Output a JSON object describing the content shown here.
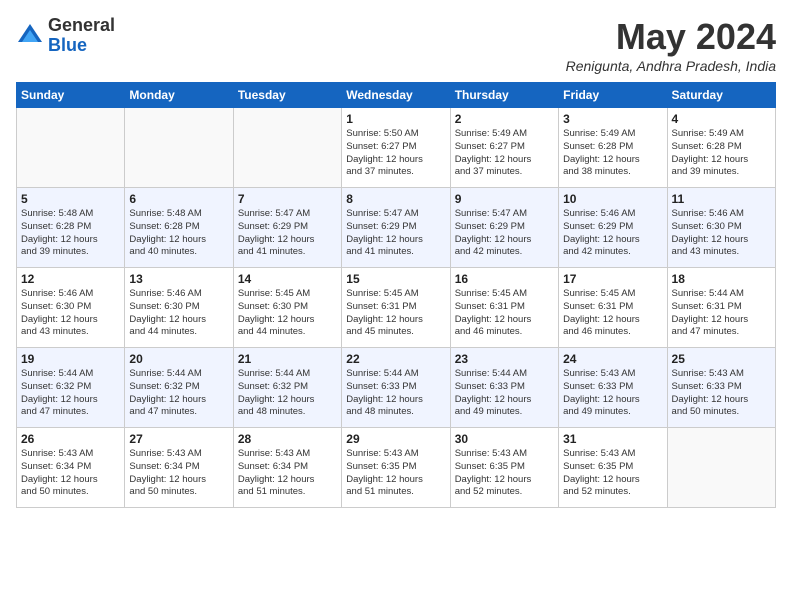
{
  "header": {
    "logo_general": "General",
    "logo_blue": "Blue",
    "month_title": "May 2024",
    "location": "Renigunta, Andhra Pradesh, India"
  },
  "days_of_week": [
    "Sunday",
    "Monday",
    "Tuesday",
    "Wednesday",
    "Thursday",
    "Friday",
    "Saturday"
  ],
  "weeks": [
    [
      {
        "day": "",
        "info": ""
      },
      {
        "day": "",
        "info": ""
      },
      {
        "day": "",
        "info": ""
      },
      {
        "day": "1",
        "info": "Sunrise: 5:50 AM\nSunset: 6:27 PM\nDaylight: 12 hours\nand 37 minutes."
      },
      {
        "day": "2",
        "info": "Sunrise: 5:49 AM\nSunset: 6:27 PM\nDaylight: 12 hours\nand 37 minutes."
      },
      {
        "day": "3",
        "info": "Sunrise: 5:49 AM\nSunset: 6:28 PM\nDaylight: 12 hours\nand 38 minutes."
      },
      {
        "day": "4",
        "info": "Sunrise: 5:49 AM\nSunset: 6:28 PM\nDaylight: 12 hours\nand 39 minutes."
      }
    ],
    [
      {
        "day": "5",
        "info": "Sunrise: 5:48 AM\nSunset: 6:28 PM\nDaylight: 12 hours\nand 39 minutes."
      },
      {
        "day": "6",
        "info": "Sunrise: 5:48 AM\nSunset: 6:28 PM\nDaylight: 12 hours\nand 40 minutes."
      },
      {
        "day": "7",
        "info": "Sunrise: 5:47 AM\nSunset: 6:29 PM\nDaylight: 12 hours\nand 41 minutes."
      },
      {
        "day": "8",
        "info": "Sunrise: 5:47 AM\nSunset: 6:29 PM\nDaylight: 12 hours\nand 41 minutes."
      },
      {
        "day": "9",
        "info": "Sunrise: 5:47 AM\nSunset: 6:29 PM\nDaylight: 12 hours\nand 42 minutes."
      },
      {
        "day": "10",
        "info": "Sunrise: 5:46 AM\nSunset: 6:29 PM\nDaylight: 12 hours\nand 42 minutes."
      },
      {
        "day": "11",
        "info": "Sunrise: 5:46 AM\nSunset: 6:30 PM\nDaylight: 12 hours\nand 43 minutes."
      }
    ],
    [
      {
        "day": "12",
        "info": "Sunrise: 5:46 AM\nSunset: 6:30 PM\nDaylight: 12 hours\nand 43 minutes."
      },
      {
        "day": "13",
        "info": "Sunrise: 5:46 AM\nSunset: 6:30 PM\nDaylight: 12 hours\nand 44 minutes."
      },
      {
        "day": "14",
        "info": "Sunrise: 5:45 AM\nSunset: 6:30 PM\nDaylight: 12 hours\nand 44 minutes."
      },
      {
        "day": "15",
        "info": "Sunrise: 5:45 AM\nSunset: 6:31 PM\nDaylight: 12 hours\nand 45 minutes."
      },
      {
        "day": "16",
        "info": "Sunrise: 5:45 AM\nSunset: 6:31 PM\nDaylight: 12 hours\nand 46 minutes."
      },
      {
        "day": "17",
        "info": "Sunrise: 5:45 AM\nSunset: 6:31 PM\nDaylight: 12 hours\nand 46 minutes."
      },
      {
        "day": "18",
        "info": "Sunrise: 5:44 AM\nSunset: 6:31 PM\nDaylight: 12 hours\nand 47 minutes."
      }
    ],
    [
      {
        "day": "19",
        "info": "Sunrise: 5:44 AM\nSunset: 6:32 PM\nDaylight: 12 hours\nand 47 minutes."
      },
      {
        "day": "20",
        "info": "Sunrise: 5:44 AM\nSunset: 6:32 PM\nDaylight: 12 hours\nand 47 minutes."
      },
      {
        "day": "21",
        "info": "Sunrise: 5:44 AM\nSunset: 6:32 PM\nDaylight: 12 hours\nand 48 minutes."
      },
      {
        "day": "22",
        "info": "Sunrise: 5:44 AM\nSunset: 6:33 PM\nDaylight: 12 hours\nand 48 minutes."
      },
      {
        "day": "23",
        "info": "Sunrise: 5:44 AM\nSunset: 6:33 PM\nDaylight: 12 hours\nand 49 minutes."
      },
      {
        "day": "24",
        "info": "Sunrise: 5:43 AM\nSunset: 6:33 PM\nDaylight: 12 hours\nand 49 minutes."
      },
      {
        "day": "25",
        "info": "Sunrise: 5:43 AM\nSunset: 6:33 PM\nDaylight: 12 hours\nand 50 minutes."
      }
    ],
    [
      {
        "day": "26",
        "info": "Sunrise: 5:43 AM\nSunset: 6:34 PM\nDaylight: 12 hours\nand 50 minutes."
      },
      {
        "day": "27",
        "info": "Sunrise: 5:43 AM\nSunset: 6:34 PM\nDaylight: 12 hours\nand 50 minutes."
      },
      {
        "day": "28",
        "info": "Sunrise: 5:43 AM\nSunset: 6:34 PM\nDaylight: 12 hours\nand 51 minutes."
      },
      {
        "day": "29",
        "info": "Sunrise: 5:43 AM\nSunset: 6:35 PM\nDaylight: 12 hours\nand 51 minutes."
      },
      {
        "day": "30",
        "info": "Sunrise: 5:43 AM\nSunset: 6:35 PM\nDaylight: 12 hours\nand 52 minutes."
      },
      {
        "day": "31",
        "info": "Sunrise: 5:43 AM\nSunset: 6:35 PM\nDaylight: 12 hours\nand 52 minutes."
      },
      {
        "day": "",
        "info": ""
      }
    ]
  ]
}
